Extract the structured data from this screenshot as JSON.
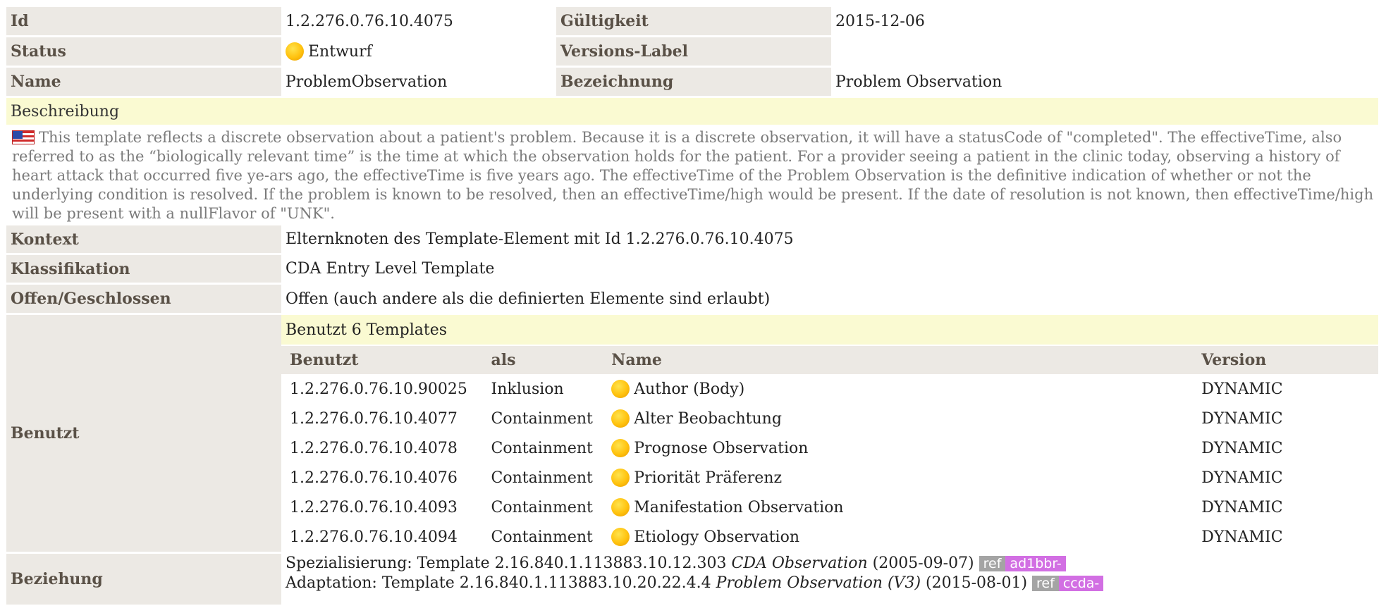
{
  "header": {
    "id_label": "Id",
    "id_value": "1.2.276.0.76.10.4075",
    "validity_label": "Gültigkeit",
    "validity_value": "2015-12-06",
    "status_label": "Status",
    "status_value": "Entwurf",
    "version_label": "Versions-Label",
    "version_value": "",
    "name_label": "Name",
    "name_value": "ProblemObservation",
    "display_label": "Bezeichnung",
    "display_value": "Problem Observation"
  },
  "description": {
    "label": "Beschreibung",
    "text": "This template reflects a discrete observation about a patient's problem. Because it is a discrete observation, it will have a statusCode of \"completed\". The effectiveTime, also referred to as the “biologically relevant time” is the time at which the observation holds for the patient. For a provider seeing a patient in the clinic today, observing a history of heart attack that occurred five ye-ars ago, the effectiveTime is five years ago. The effectiveTime of the Problem Observation is the definitive indication of whether or not the underlying condition is resolved. If the problem is known to be resolved, then an effectiveTime/high would be present. If the date of resolution is not known, then effectiveTime/high will be present with a nullFlavor of \"UNK\"."
  },
  "details": {
    "context_label": "Kontext",
    "context_value": "Elternknoten des Template-Element mit Id 1.2.276.0.76.10.4075",
    "classification_label": "Klassifikation",
    "classification_value": "CDA Entry Level Template",
    "openclosed_label": "Offen/Geschlossen",
    "openclosed_value": "Offen (auch andere als die definierten Elemente sind erlaubt)"
  },
  "uses": {
    "label": "Benutzt",
    "heading": "Benutzt 6 Templates",
    "columns": [
      "Benutzt",
      "als",
      "Name",
      "Version"
    ],
    "rows": [
      {
        "id": "1.2.276.0.76.10.90025",
        "as": "Inklusion",
        "name": "Author (Body)",
        "version": "DYNAMIC"
      },
      {
        "id": "1.2.276.0.76.10.4077",
        "as": "Containment",
        "name": "Alter Beobachtung",
        "version": "DYNAMIC"
      },
      {
        "id": "1.2.276.0.76.10.4078",
        "as": "Containment",
        "name": "Prognose Observation",
        "version": "DYNAMIC"
      },
      {
        "id": "1.2.276.0.76.10.4076",
        "as": "Containment",
        "name": "Priorität Präferenz",
        "version": "DYNAMIC"
      },
      {
        "id": "1.2.276.0.76.10.4093",
        "as": "Containment",
        "name": "Manifestation Observation",
        "version": "DYNAMIC"
      },
      {
        "id": "1.2.276.0.76.10.4094",
        "as": "Containment",
        "name": "Etiology Observation",
        "version": "DYNAMIC"
      }
    ]
  },
  "relationship": {
    "label": "Beziehung",
    "items": [
      {
        "prefix": "Spezialisierung: Template 2.16.840.1.113883.10.12.303 ",
        "title": "CDA Observation",
        "date": " (2005-09-07) ",
        "ref_key": "ref",
        "ref_val": "ad1bbr-"
      },
      {
        "prefix": "Adaptation: Template 2.16.840.1.113883.10.20.22.4.4 ",
        "title": "Problem Observation (V3)",
        "date": " (2015-08-01) ",
        "ref_key": "ref",
        "ref_val": "ccda-"
      }
    ]
  },
  "icons": {
    "status": "status-draft-icon",
    "flag": "us-flag-icon"
  },
  "colors": {
    "label_bg": "#ece9e4",
    "highlight_bg": "#fafad2",
    "status_dot": "#ffc20e",
    "ref_key_bg": "#a4a4a4",
    "ref_val_bg": "#d26fe3"
  }
}
